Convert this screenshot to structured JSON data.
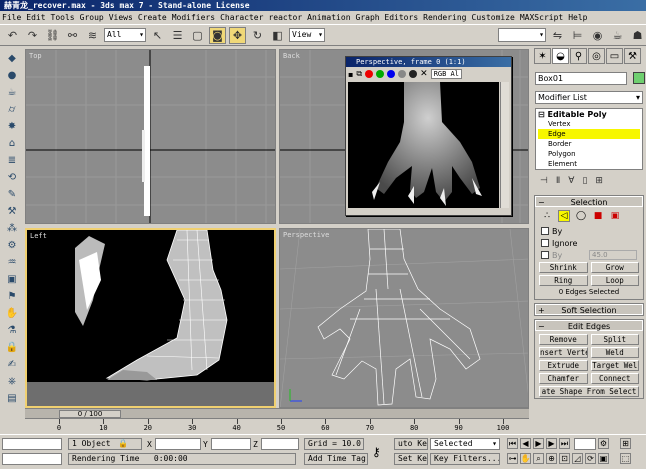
{
  "title": "赫青龙_recover.max - 3ds max 7 - Stand-alone License",
  "menu": [
    "File",
    "Edit",
    "Tools",
    "Group",
    "Views",
    "Create",
    "Modifiers",
    "Character",
    "reactor",
    "Animation",
    "Graph Editors",
    "Rendering",
    "Customize",
    "MAXScript",
    "Help"
  ],
  "toolbar": {
    "filter": "All",
    "refcoord": "View"
  },
  "viewports": {
    "top": "Top",
    "back": "Back",
    "left": "Left",
    "perspective": "Perspective"
  },
  "render_window": {
    "title": "Perspective, frame 0 (1:1)",
    "channel": "RGB Al"
  },
  "command_panel": {
    "object_name": "Box01",
    "modifier_list": "Modifier List",
    "stack": {
      "root": "Editable Poly",
      "items": [
        "Vertex",
        "Edge",
        "Border",
        "Polygon",
        "Element"
      ],
      "selected": "Edge"
    },
    "selection": {
      "title": "Selection",
      "by": "By",
      "ignore": "Ignore",
      "by_angle": "By",
      "angle_value": "45.0",
      "shrink": "Shrink",
      "grow": "Grow",
      "ring": "Ring",
      "loop": "Loop",
      "info": "0 Edges Selected"
    },
    "soft_selection": {
      "title": "Soft Selection"
    },
    "edit_edges": {
      "title": "Edit Edges",
      "buttons": [
        [
          "Remove",
          "Split"
        ],
        [
          "nsert Verte",
          "Weld"
        ],
        [
          "Extrude",
          "Target Wel"
        ],
        [
          "Chamfer",
          "Connect"
        ]
      ],
      "create_shape": "ate Shape From Select"
    }
  },
  "timeline": {
    "slider": "0 / 100",
    "ticks": [
      0,
      10,
      20,
      30,
      40,
      50,
      60,
      70,
      80,
      90,
      100
    ]
  },
  "status": {
    "objects": "1 Object",
    "x_label": "X",
    "y_label": "Y",
    "z_label": "Z",
    "grid": "Grid = 10.0",
    "rendering_time": "Rendering Time",
    "time_value": "0:00:00",
    "add_time_tag": "Add Time Tag",
    "auto_key": "uto Key",
    "selected": "Selected",
    "set_key": "Set Key",
    "key_filters": "Key Filters..."
  }
}
